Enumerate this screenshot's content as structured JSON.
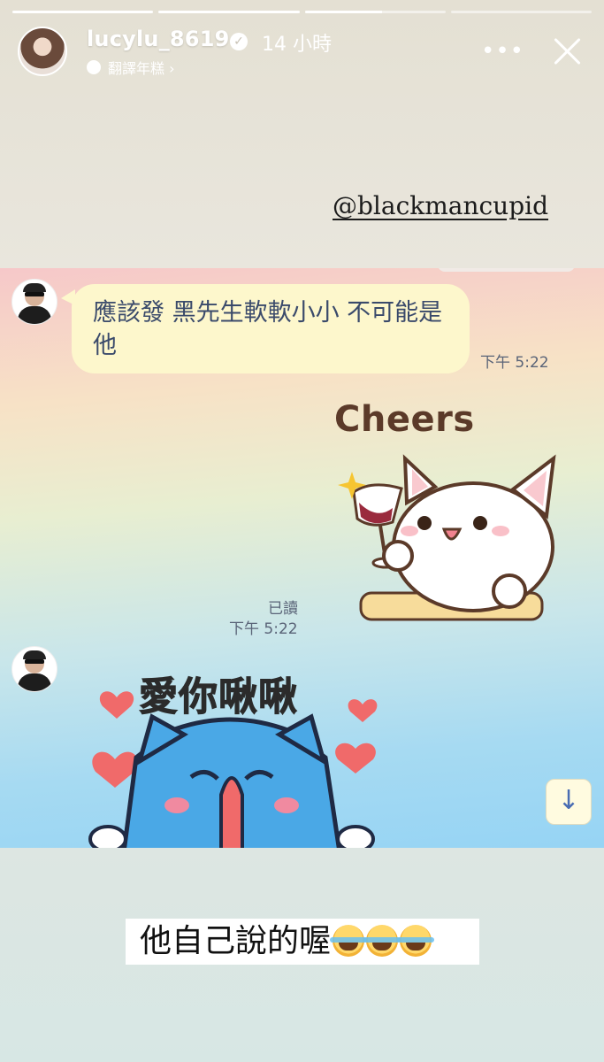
{
  "story": {
    "progress_segments": [
      1,
      1,
      0.55,
      0
    ],
    "username": "lucylu_8619",
    "time_ago": "14 小時",
    "translate_label": "翻譯年糕 ›",
    "more_label": "•••",
    "mention": "@blackmancupid",
    "caption": "他自己說的喔"
  },
  "chat": {
    "messages": [
      {
        "text": "應該發 黑先生軟軟小小 不可能是他",
        "time": "下午 5:22"
      }
    ],
    "stickers": [
      {
        "caption": "Cheers",
        "read_status": "已讀",
        "time": "下午 5:22"
      },
      {
        "caption": "愛你啾啾"
      }
    ],
    "scroll_down_label": "↓"
  },
  "colors": {
    "bubble": "#fdf7cc",
    "bubble_text": "#3a4a6b",
    "sticker_cat_outline": "#5b3a29",
    "heart": "#f06a6a",
    "bunny": "#4aa8e6"
  }
}
